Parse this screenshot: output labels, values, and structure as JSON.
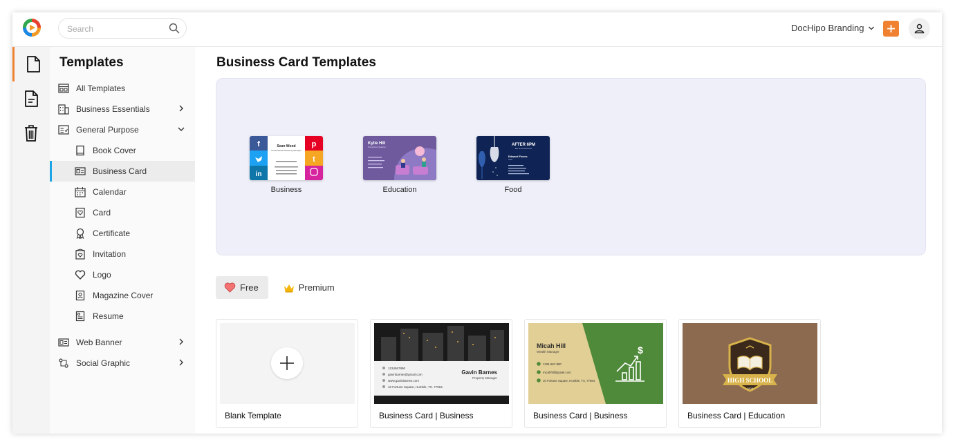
{
  "topbar": {
    "search_placeholder": "Search",
    "brand_label": "DocHipo Branding",
    "add_icon": "plus-icon",
    "user_icon": "user-icon"
  },
  "rail": {
    "items": [
      {
        "icon": "document-icon",
        "active": true
      },
      {
        "icon": "page-list-icon",
        "active": false
      },
      {
        "icon": "trash-icon",
        "active": false
      }
    ]
  },
  "sidebar": {
    "title": "Templates",
    "items": [
      {
        "label": "All Templates"
      },
      {
        "label": "Business Essentials"
      },
      {
        "label": "General Purpose"
      },
      {
        "label": "Book Cover"
      },
      {
        "label": "Business Card"
      },
      {
        "label": "Calendar"
      },
      {
        "label": "Card"
      },
      {
        "label": "Certificate"
      },
      {
        "label": "Invitation"
      },
      {
        "label": "Logo"
      },
      {
        "label": "Magazine Cover"
      },
      {
        "label": "Resume"
      },
      {
        "label": "Web Banner"
      },
      {
        "label": "Social Graphic"
      }
    ]
  },
  "main": {
    "title": "Business Card Templates",
    "categories": [
      {
        "label": "Business"
      },
      {
        "label": "Education"
      },
      {
        "label": "Food"
      }
    ],
    "tabs": [
      {
        "label": "Free"
      },
      {
        "label": "Premium"
      }
    ],
    "cards": [
      {
        "title": "Blank Template"
      },
      {
        "title": "Business Card | Business"
      },
      {
        "title": "Business Card | Business"
      },
      {
        "title": "Business Card | Education"
      }
    ]
  },
  "thumbs": {
    "business": {
      "name": "Sean Wood",
      "role": "Social Media Marketing Manager"
    },
    "education": {
      "name": "Kylie Hill",
      "role": "Pre-school Teacher"
    },
    "food": {
      "headline": "AFTER 6PM",
      "sub": "Bar and Restaurant",
      "name": "Edward Flores",
      "role": "Chef"
    },
    "card2": {
      "name": "Gavin Barnes",
      "role": "Property Manager",
      "phone": "1234567890",
      "email": "gavinbarnes@gmail.com",
      "web": "www.gavinbarnes.com",
      "address": "10 Fortune Square, Humble, TX. 77564"
    },
    "card3": {
      "name": "Micah Hill",
      "role": "Wealth Manager",
      "phone": "1234-567-890",
      "email": "micahhill@gmail.com",
      "address": "10 Fortune Square, Humble, TX, 77564"
    },
    "card4": {
      "banner": "HIGH SCHOOL",
      "year": "1808"
    }
  },
  "colors": {
    "accent": "#f08130",
    "active_indicator": "#1ea5e6",
    "hero_bg": "#eeeff9",
    "card3_green": "#4f8a3a",
    "card3_tan": "#e2cf96",
    "card4_brown": "#8b6a4f",
    "edu_purple": "#6e5a9c",
    "food_navy": "#0f2454"
  }
}
